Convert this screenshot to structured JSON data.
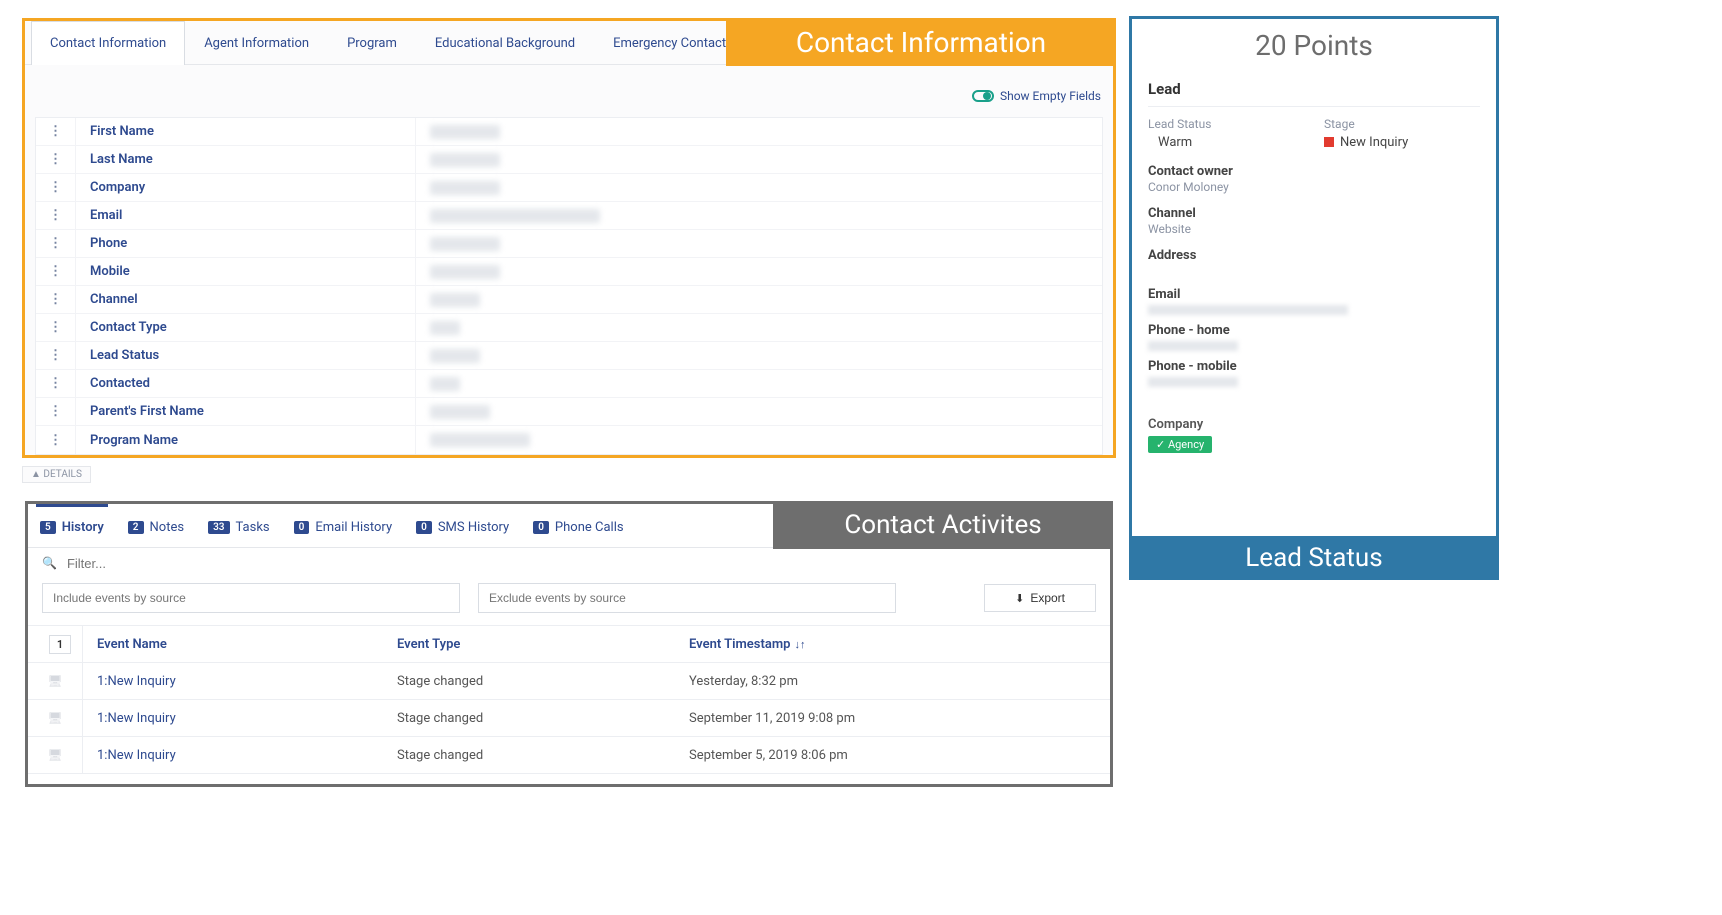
{
  "contact_info": {
    "banner": "Contact Information",
    "tabs": [
      "Contact Information",
      "Agent Information",
      "Program",
      "Educational Background",
      "Emergency Contact"
    ],
    "show_empty_label": "Show Empty Fields",
    "fields": [
      {
        "label": "First Name"
      },
      {
        "label": "Last Name"
      },
      {
        "label": "Company"
      },
      {
        "label": "Email"
      },
      {
        "label": "Phone"
      },
      {
        "label": "Mobile"
      },
      {
        "label": "Channel"
      },
      {
        "label": "Contact Type"
      },
      {
        "label": "Lead Status"
      },
      {
        "label": "Contacted"
      },
      {
        "label": "Parent's First Name"
      },
      {
        "label": "Program Name"
      }
    ],
    "details_collapse": "DETAILS"
  },
  "activities": {
    "banner": "Contact Activites",
    "tabs": [
      {
        "count": "5",
        "label": "History"
      },
      {
        "count": "2",
        "label": "Notes"
      },
      {
        "count": "33",
        "label": "Tasks"
      },
      {
        "count": "0",
        "label": "Email History"
      },
      {
        "count": "0",
        "label": "SMS History"
      },
      {
        "count": "0",
        "label": "Phone Calls"
      }
    ],
    "filter_placeholder": "Filter...",
    "include_placeholder": "Include events by source",
    "exclude_placeholder": "Exclude events by source",
    "export_label": "Export",
    "header_count": "1",
    "columns": {
      "name": "Event Name",
      "type": "Event Type",
      "ts": "Event Timestamp"
    },
    "rows": [
      {
        "name": "1:New Inquiry",
        "type": "Stage changed",
        "ts": "Yesterday, 8:32 pm"
      },
      {
        "name": "1:New Inquiry",
        "type": "Stage changed",
        "ts": "September 11, 2019 9:08 pm"
      },
      {
        "name": "1:New Inquiry",
        "type": "Stage changed",
        "ts": "September 5, 2019 8:06 pm"
      }
    ]
  },
  "lead": {
    "points": "20 Points",
    "title": "Lead",
    "status_label": "Lead Status",
    "status_value": "Warm",
    "stage_label": "Stage",
    "stage_value": "New Inquiry",
    "owner_label": "Contact owner",
    "owner_value": "Conor Moloney",
    "channel_label": "Channel",
    "channel_value": "Website",
    "address_label": "Address",
    "email_label": "Email",
    "phone_home_label": "Phone - home",
    "phone_mobile_label": "Phone - mobile",
    "company_label": "Company",
    "company_tag": "✓ Agency",
    "banner": "Lead Status"
  }
}
